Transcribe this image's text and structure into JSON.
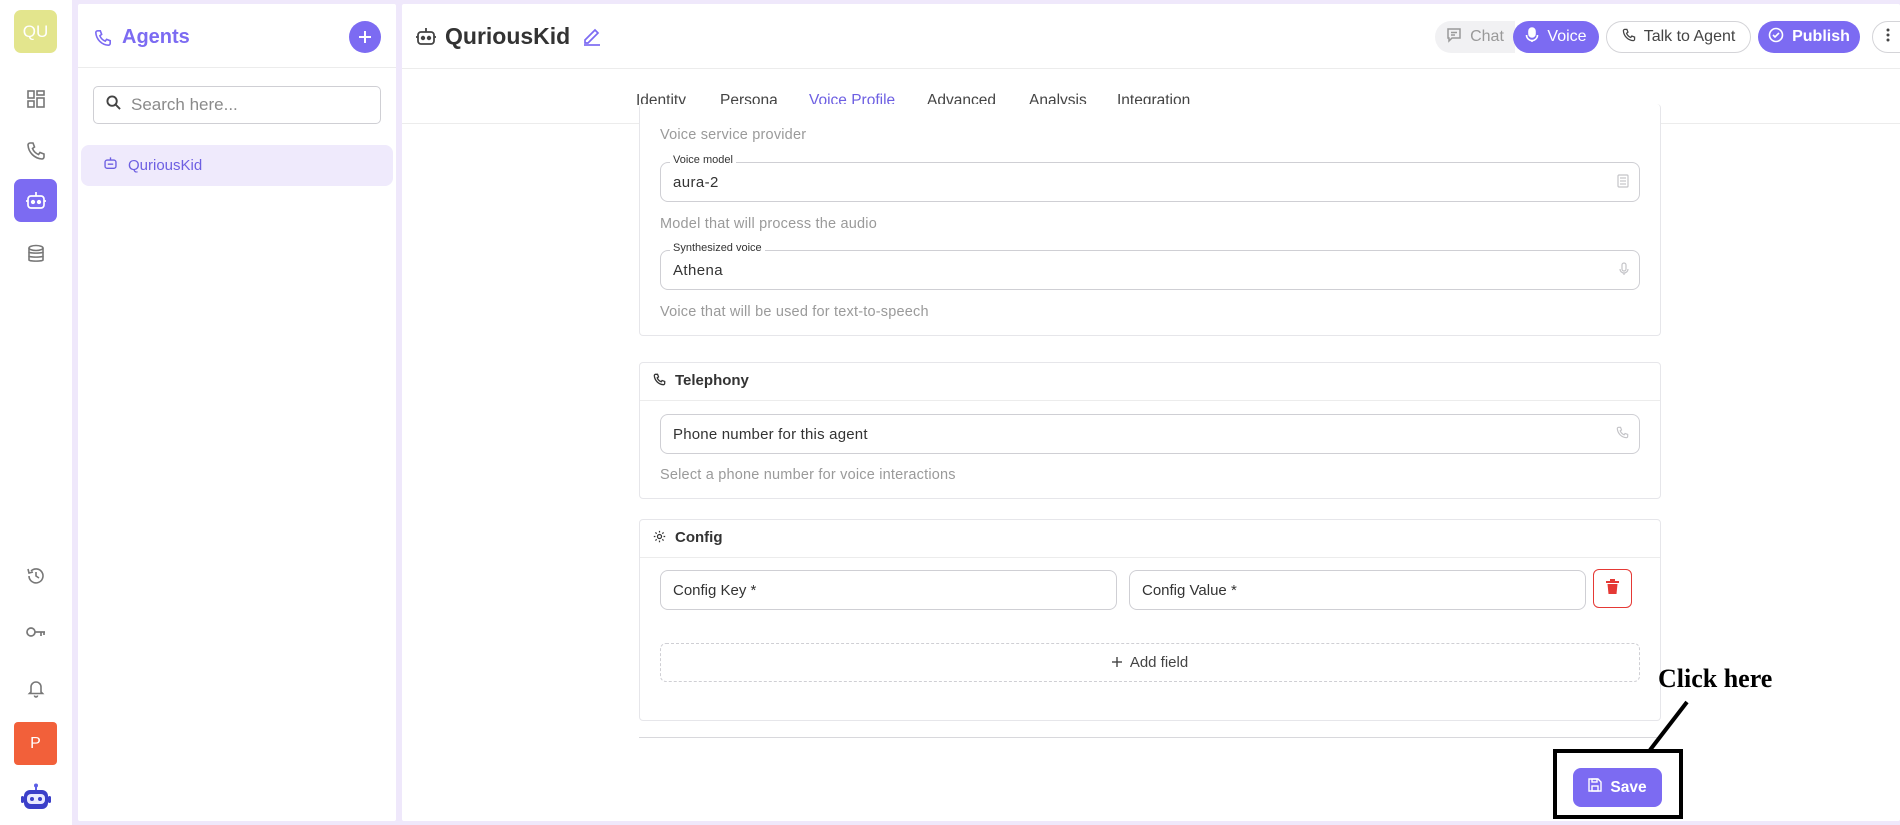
{
  "workspace": {
    "initials": "QU",
    "color": "#e3e58d"
  },
  "rail": {
    "items": [
      {
        "icon": "dashboard-icon"
      },
      {
        "icon": "phone-icon"
      },
      {
        "icon": "robot-icon",
        "active": true
      },
      {
        "icon": "database-icon"
      },
      {
        "icon": "history-icon"
      },
      {
        "icon": "key-icon"
      },
      {
        "icon": "bell-icon"
      }
    ],
    "avatar_initial": "P",
    "avatar_color": "#f2603a"
  },
  "agents_panel": {
    "title": "Agents",
    "search_placeholder": "Search here...",
    "items": [
      {
        "label": "QuriousKid",
        "selected": true
      }
    ]
  },
  "header": {
    "agent_name": "QuriousKid",
    "chat_label": "Chat",
    "voice_label": "Voice",
    "talk_label": "Talk to Agent",
    "publish_label": "Publish"
  },
  "tabs": [
    {
      "label": "Identity"
    },
    {
      "label": "Persona"
    },
    {
      "label": "Voice Profile",
      "active": true
    },
    {
      "label": "Advanced"
    },
    {
      "label": "Analysis"
    },
    {
      "label": "Integration"
    }
  ],
  "voice": {
    "provider_help": "Voice service provider",
    "model_label": "Voice model",
    "model_value": "aura-2",
    "model_help": "Model that will process the audio",
    "synth_label": "Synthesized voice",
    "synth_value": "Athena",
    "synth_help": "Voice that will be used for text-to-speech"
  },
  "telephony": {
    "title": "Telephony",
    "placeholder": "Phone number for this agent",
    "help": "Select a phone number for voice interactions"
  },
  "config": {
    "title": "Config",
    "key_placeholder": "Config Key *",
    "value_placeholder": "Config Value *",
    "add_field_label": "Add field"
  },
  "save_label": "Save",
  "annotation": "Click here",
  "accent_color": "#7c6bf2",
  "danger_color": "#e53935"
}
